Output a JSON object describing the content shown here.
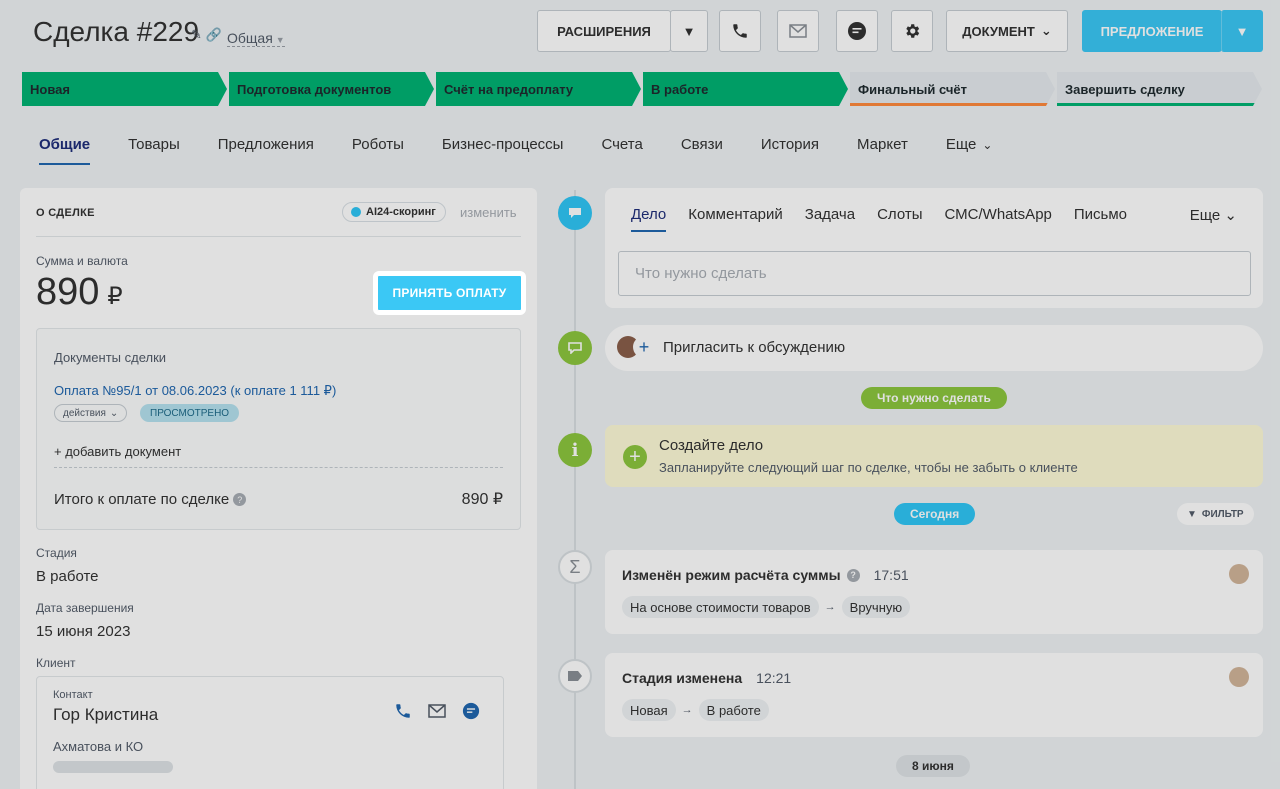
{
  "header": {
    "title": "Сделка #229",
    "category": "Общая",
    "extensions_label": "РАСШИРЕНИЯ",
    "document_label": "ДОКУМЕНТ",
    "offer_label": "ПРЕДЛОЖЕНИЕ"
  },
  "stages": [
    "Новая",
    "Подготовка документов",
    "Счёт на предоплату",
    "В работе",
    "Финальный счёт",
    "Завершить сделку"
  ],
  "tabs": [
    "Общие",
    "Товары",
    "Предложения",
    "Роботы",
    "Бизнес-процессы",
    "Счета",
    "Связи",
    "История",
    "Маркет",
    "Еще"
  ],
  "about": {
    "title": "О СДЕЛКЕ",
    "ai_label": "AI24-скоринг",
    "change_label": "изменить",
    "sum_label": "Сумма и валюта",
    "sum_value": "890",
    "currency": "₽",
    "accept_button": "ПРИНЯТЬ ОПЛАТУ",
    "docs_title": "Документы сделки",
    "payment_link": "Оплата №95/1 от 08.06.2023 (к оплате 1 111 ₽)",
    "actions_label": "действия",
    "seen_label": "просмотрено",
    "add_doc": "+ добавить документ",
    "total_label": "Итого к оплате по сделке",
    "total_value": "890 ₽",
    "stage_label": "Стадия",
    "stage_value": "В работе",
    "close_label": "Дата завершения",
    "close_value": "15 июня 2023",
    "client_label": "Клиент",
    "contact_type": "Контакт",
    "contact_name": "Гор Кристина",
    "company": "Ахматова и КО"
  },
  "timeline": {
    "compose_tabs": [
      "Дело",
      "Комментарий",
      "Задача",
      "Слоты",
      "СМС/WhatsApp",
      "Письмо"
    ],
    "compose_more": "Еще",
    "compose_placeholder": "Что нужно сделать",
    "invite_text": "Пригласить к обсуждению",
    "todo_badge": "Что нужно сделать",
    "create_title": "Создайте дело",
    "create_sub": "Запланируйте следующий шаг по сделке, чтобы не забыть о клиенте",
    "today_badge": "Сегодня",
    "filter_label": "ФИЛЬТР",
    "event1_title": "Изменён режим расчёта суммы",
    "event1_time": "17:51",
    "event1_from": "На основе стоимости товаров",
    "event1_to": "Вручную",
    "event2_title": "Стадия изменена",
    "event2_time": "12:21",
    "event2_from": "Новая",
    "event2_to": "В работе",
    "date_badge": "8 июня"
  },
  "colors": {
    "accent": "#3bc8f5",
    "stage_done": "#00b373",
    "link": "#2067b0",
    "timeline_green": "#8cc63e"
  }
}
